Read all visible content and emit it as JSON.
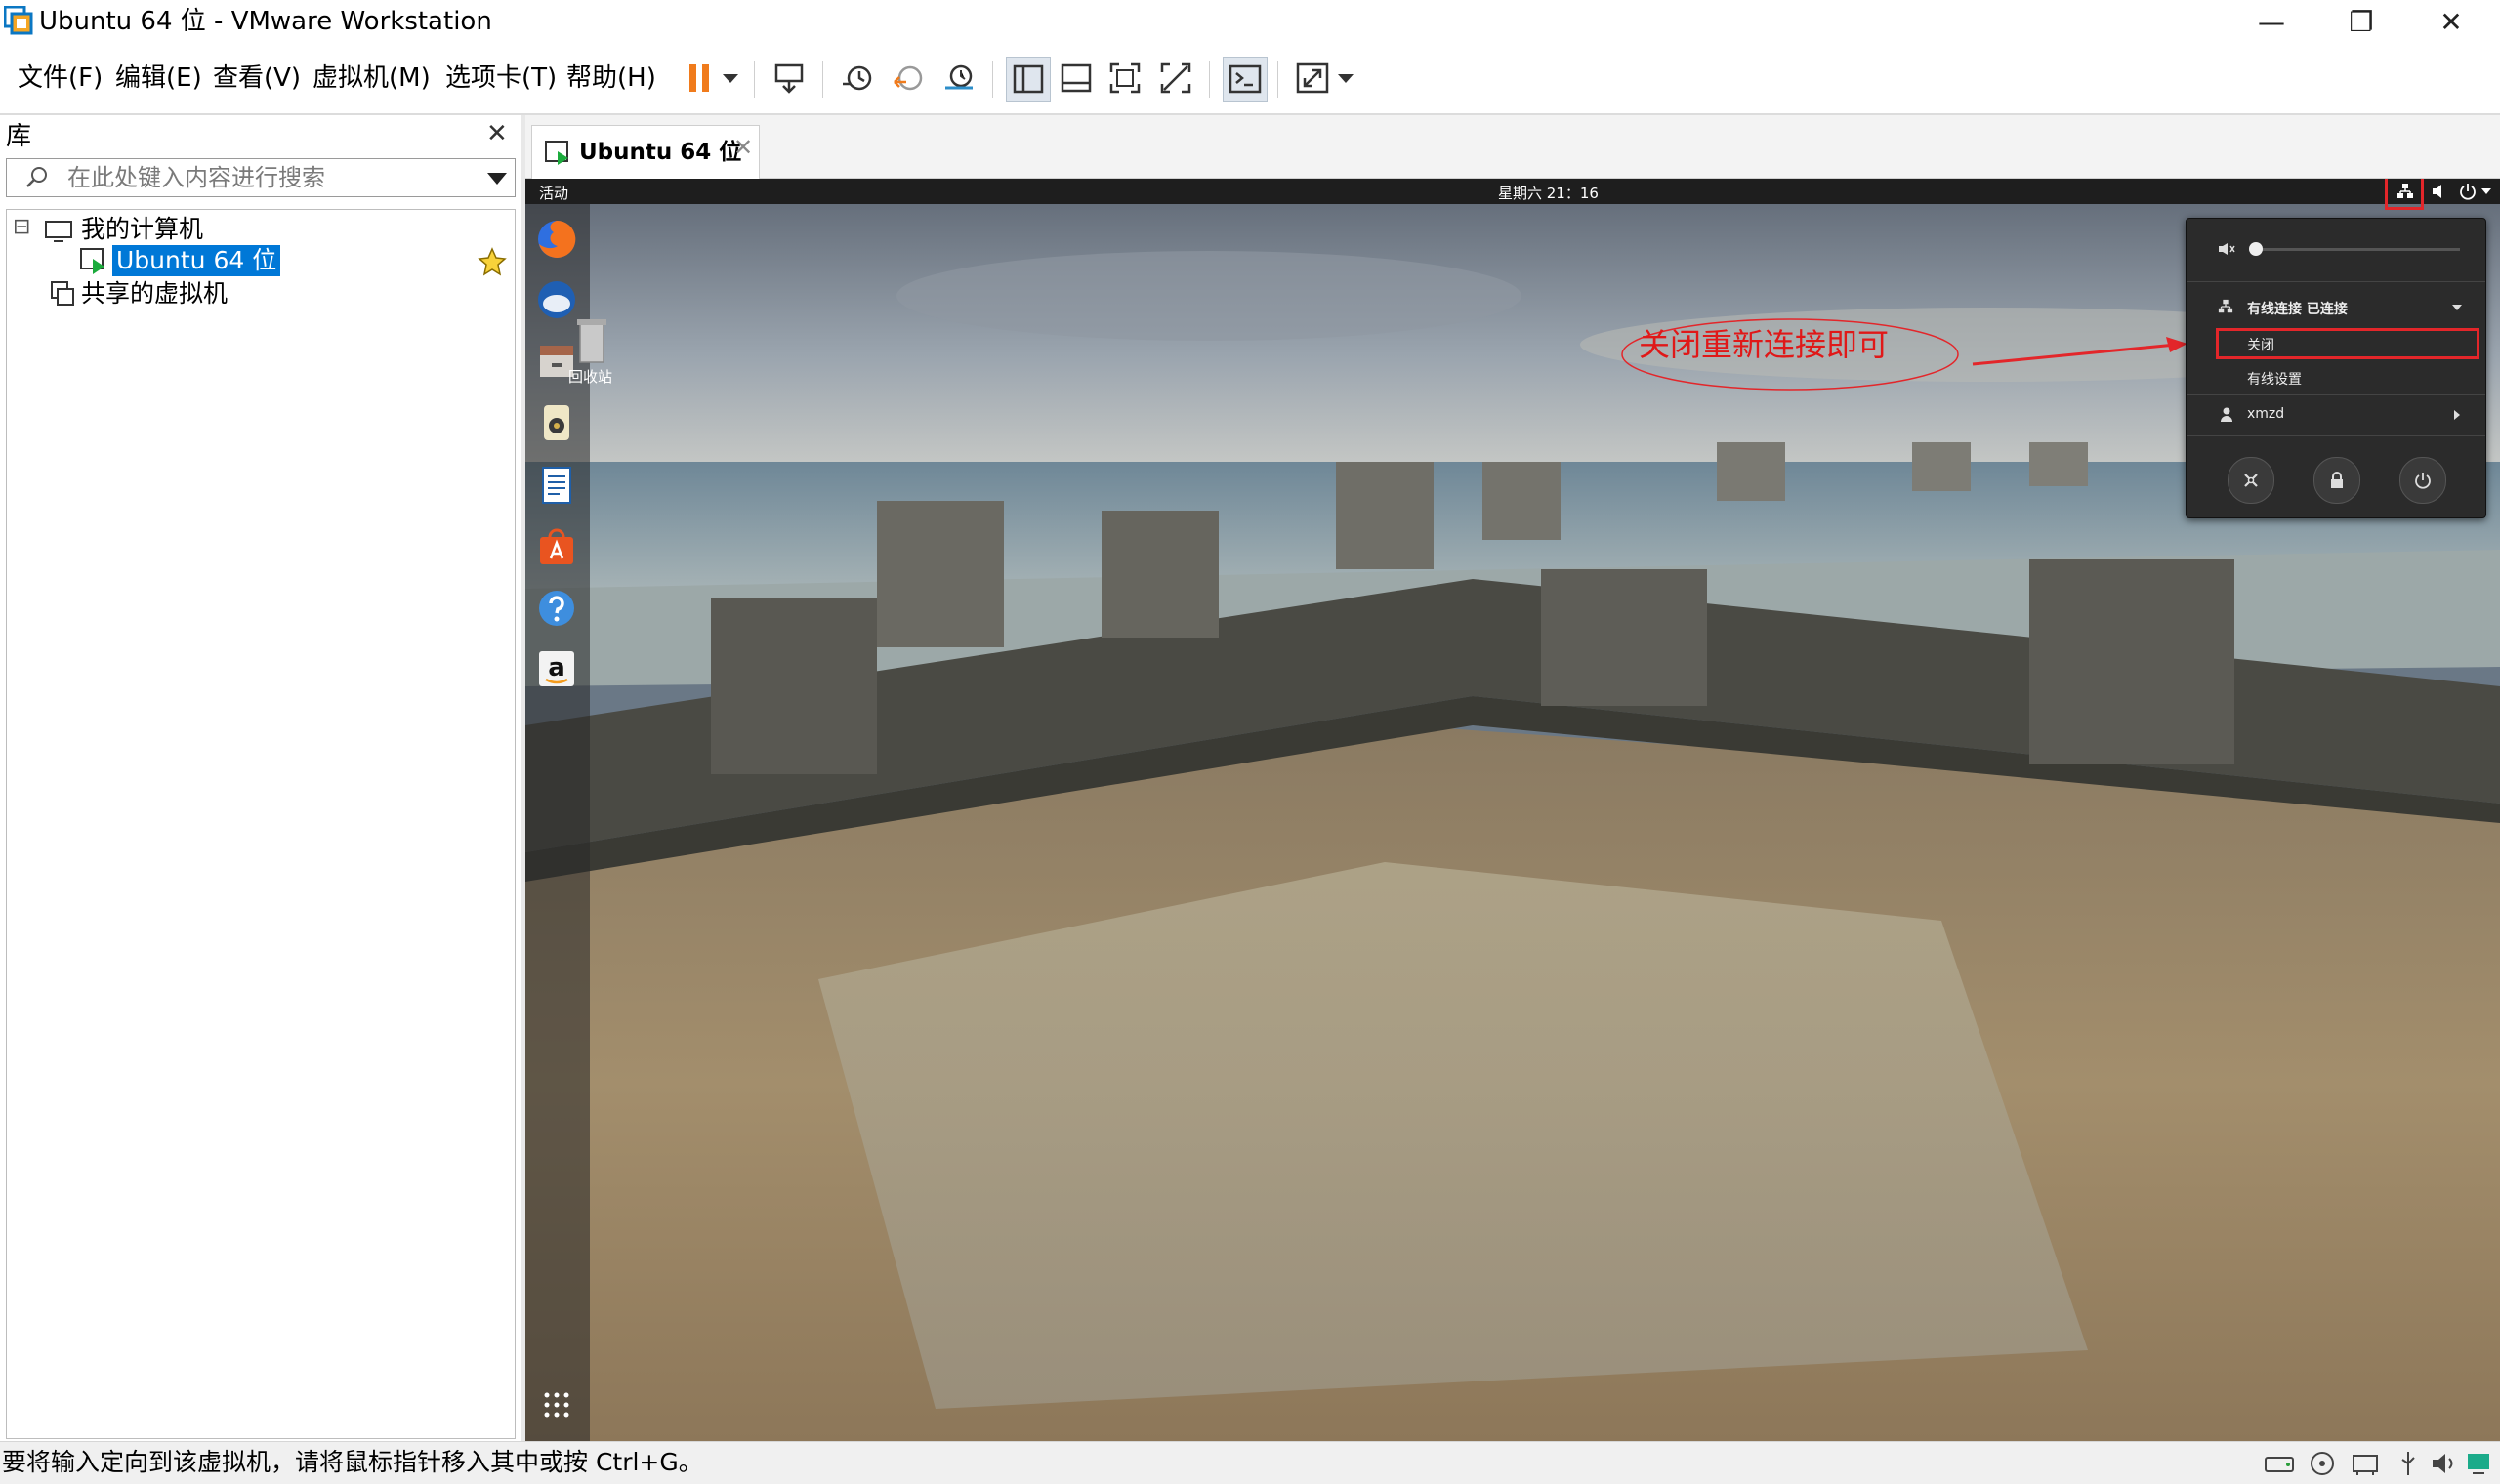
{
  "window": {
    "title": "Ubuntu 64 位 - VMware Workstation",
    "controls": [
      "—",
      "❐",
      "✕"
    ]
  },
  "menu": {
    "items": [
      "文件(F)",
      "编辑(E)",
      "查看(V)",
      "虚拟机(M)",
      "选项卡(T)",
      "帮助(H)"
    ]
  },
  "library": {
    "title": "库",
    "close": "✕",
    "search_placeholder": "在此处键入内容进行搜索",
    "tree": {
      "expander": "⊟",
      "my_computer": "我的计算机",
      "vm_name": "Ubuntu 64 位",
      "shared": "共享的虚拟机"
    }
  },
  "tab": {
    "label": "Ubuntu 64 位",
    "close": "✕"
  },
  "guest": {
    "activities": "活动",
    "clock": "星期六 21：16",
    "trash_label": "回收站",
    "popup": {
      "wired_header": "有线连接 已连接",
      "turn_off": "关闭",
      "wired_settings": "有线设置",
      "user": "xmzd"
    },
    "annotation": "关闭重新连接即可",
    "accent": "#e3262a"
  },
  "statusbar": {
    "text": "要将输入定向到该虚拟机，请将鼠标指针移入其中或按 Ctrl+G。"
  }
}
